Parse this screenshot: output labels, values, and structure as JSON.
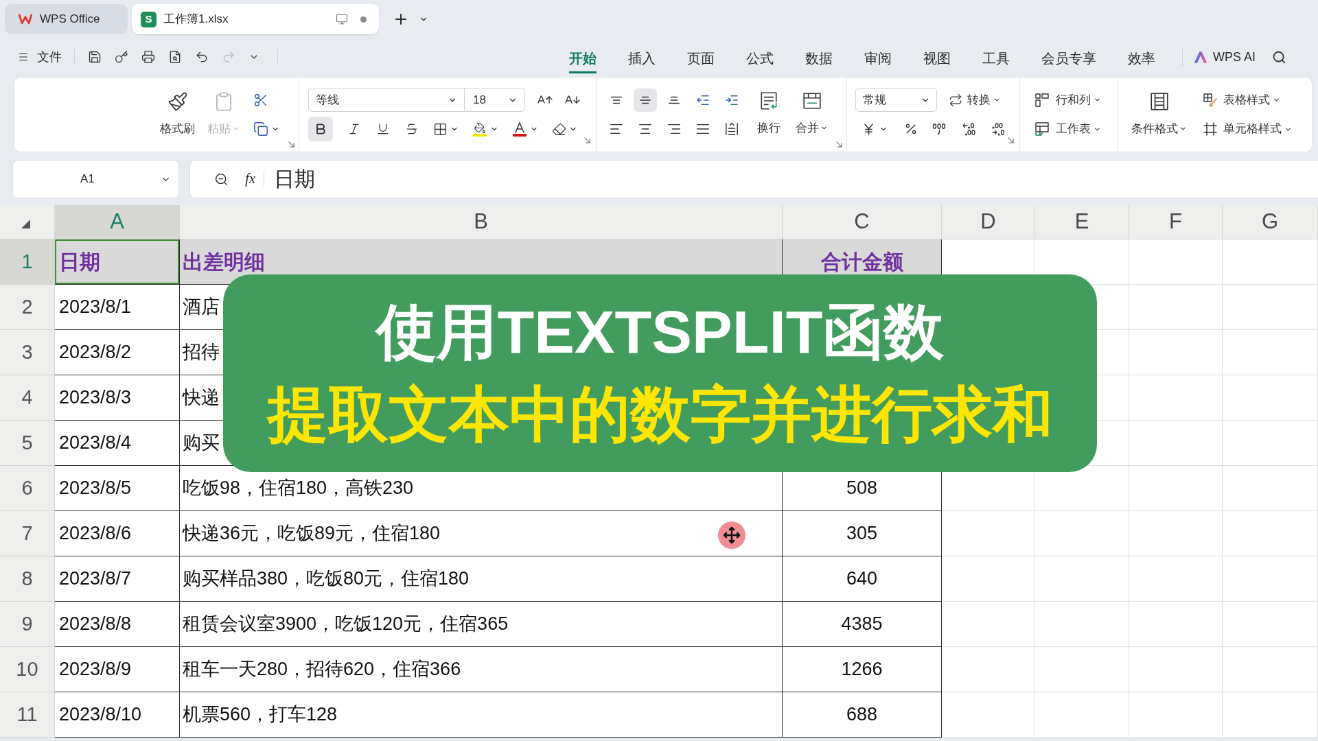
{
  "tabs": [
    {
      "kind": "home",
      "label": "WPS Office",
      "selected": false
    },
    {
      "kind": "sheet",
      "badge": "S",
      "label": "工作簿1.xlsx",
      "selected": true
    }
  ],
  "menu": {
    "file": "文件",
    "quick_access": [
      {
        "kind": "save",
        "disabled": false
      },
      {
        "kind": "key",
        "disabled": false
      },
      {
        "kind": "print",
        "disabled": false
      },
      {
        "kind": "preview",
        "disabled": false
      },
      {
        "kind": "undo",
        "disabled": false
      },
      {
        "kind": "redo",
        "disabled": true
      },
      {
        "kind": "more",
        "disabled": false
      }
    ],
    "tabs": [
      {
        "label": "开始",
        "selected": true
      },
      {
        "label": "插入",
        "selected": false
      },
      {
        "label": "页面",
        "selected": false
      },
      {
        "label": "公式",
        "selected": false
      },
      {
        "label": "数据",
        "selected": false
      },
      {
        "label": "审阅",
        "selected": false
      },
      {
        "label": "视图",
        "selected": false
      },
      {
        "label": "工具",
        "selected": false
      },
      {
        "label": "会员专享",
        "selected": false
      },
      {
        "label": "效率",
        "selected": false
      }
    ],
    "ai": "WPS AI"
  },
  "ribbon": {
    "clipboard": [
      {
        "kind": "format_painter",
        "label": "格式刷",
        "disabled": false
      },
      {
        "kind": "paste",
        "label": "粘贴",
        "disabled": true
      }
    ],
    "font_name": "等线",
    "font_size": "18",
    "styles": [
      {
        "kind": "bold",
        "selected": true
      },
      {
        "kind": "italic",
        "selected": false
      },
      {
        "kind": "underline",
        "selected": false
      },
      {
        "kind": "strikethrough",
        "selected": false
      }
    ],
    "vertical_align": [
      {
        "kind": "top",
        "selected": false
      },
      {
        "kind": "middle",
        "selected": true
      },
      {
        "kind": "bottom",
        "selected": false
      }
    ],
    "wrap": "换行",
    "merge": "合并",
    "number_format": "常规",
    "convert": "转换",
    "rows_columns": "行和列",
    "worksheet": "工作表",
    "conditional_format": "条件格式",
    "table_style": "表格样式",
    "cell_style": "单元格样式"
  },
  "formula_bar": {
    "cell": "A1",
    "fx": "fx",
    "value": "日期"
  },
  "sheet": {
    "columns": [
      {
        "label": "A",
        "selected": true
      },
      {
        "label": "B",
        "selected": false
      },
      {
        "label": "C",
        "selected": false
      },
      {
        "label": "D",
        "selected": false
      },
      {
        "label": "E",
        "selected": false
      },
      {
        "label": "F",
        "selected": false
      },
      {
        "label": "G",
        "selected": false
      }
    ],
    "rows": [
      {
        "number": "1",
        "kind": "header",
        "selected": true,
        "cells": [
          "日期",
          "出差明细",
          "合计金额"
        ]
      },
      {
        "number": "2",
        "kind": "data",
        "selected": false,
        "cells": [
          "2023/8/1",
          "酒店"
        ]
      },
      {
        "number": "3",
        "kind": "data",
        "selected": false,
        "cells": [
          "2023/8/2",
          "招待"
        ]
      },
      {
        "number": "4",
        "kind": "data",
        "selected": false,
        "cells": [
          "2023/8/3",
          "快递"
        ]
      },
      {
        "number": "5",
        "kind": "data",
        "selected": false,
        "cells": [
          "2023/8/4",
          "购买"
        ]
      },
      {
        "number": "6",
        "kind": "data",
        "selected": false,
        "cells": [
          "2023/8/5",
          "吃饭98，住宿180，高铁230",
          "508"
        ]
      },
      {
        "number": "7",
        "kind": "data",
        "selected": false,
        "cells": [
          "2023/8/6",
          "快递36元，吃饭89元，住宿180",
          "305"
        ]
      },
      {
        "number": "8",
        "kind": "data",
        "selected": false,
        "cells": [
          "2023/8/7",
          "购买样品380，吃饭80元，住宿180",
          "640"
        ]
      },
      {
        "number": "9",
        "kind": "data",
        "selected": false,
        "cells": [
          "2023/8/8",
          "租赁会议室3900，吃饭120元，住宿365",
          "4385"
        ]
      },
      {
        "number": "10",
        "kind": "data",
        "selected": false,
        "cells": [
          "2023/8/9",
          "租车一天280，招待620，住宿366",
          "1266"
        ]
      },
      {
        "number": "11",
        "kind": "data",
        "selected": false,
        "cells": [
          "2023/8/10",
          "机票560，打车128",
          "688"
        ]
      }
    ]
  },
  "banner": {
    "title": "使用TEXTSPLIT函数",
    "subtitle": "提取文本中的数字并进行求和"
  }
}
